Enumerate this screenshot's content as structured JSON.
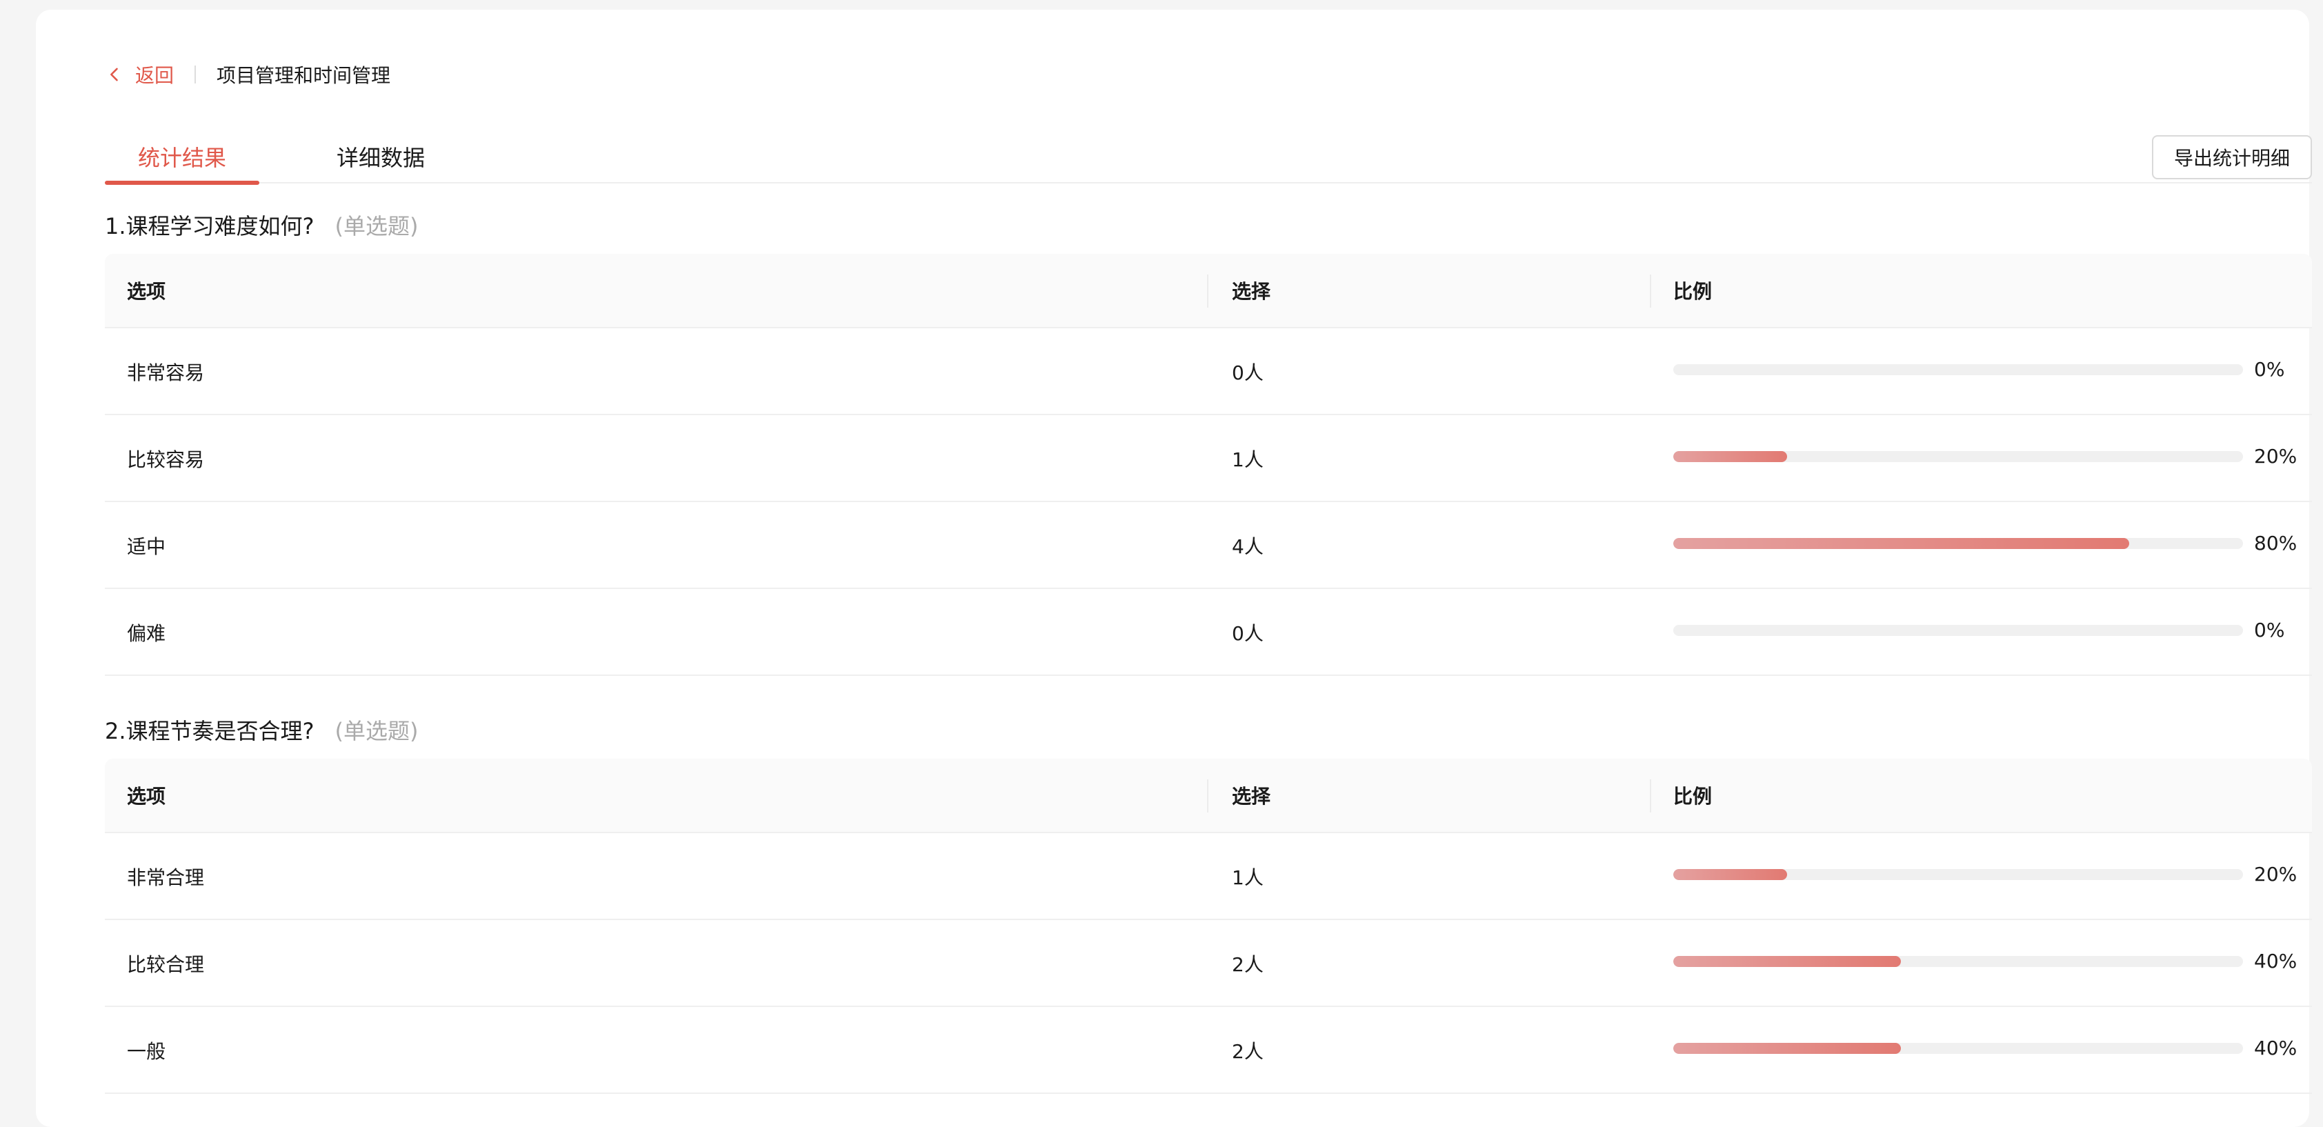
{
  "breadcrumb": {
    "back_label": "返回",
    "title": "项目管理和时间管理"
  },
  "tabs": [
    {
      "label": "统计结果",
      "active": true
    },
    {
      "label": "详细数据",
      "active": false
    }
  ],
  "export_label": "导出统计明细",
  "colors": {
    "accent": "#e0584a",
    "bar_light": "#e4a1a0",
    "bar_dark": "#e27a72",
    "track": "#f0f0f0"
  },
  "table_headers": {
    "option": "选项",
    "count": "选择",
    "ratio": "比例"
  },
  "questions": [
    {
      "title": "1.课程学习难度如何?",
      "type": "(单选题)",
      "rows": [
        {
          "option": "非常容易",
          "count": "0人",
          "percent": 0,
          "percent_label": "0%"
        },
        {
          "option": "比较容易",
          "count": "1人",
          "percent": 20,
          "percent_label": "20%"
        },
        {
          "option": "适中",
          "count": "4人",
          "percent": 80,
          "percent_label": "80%"
        },
        {
          "option": "偏难",
          "count": "0人",
          "percent": 0,
          "percent_label": "0%"
        }
      ]
    },
    {
      "title": "2.课程节奏是否合理?",
      "type": "(单选题)",
      "rows": [
        {
          "option": "非常合理",
          "count": "1人",
          "percent": 20,
          "percent_label": "20%"
        },
        {
          "option": "比较合理",
          "count": "2人",
          "percent": 40,
          "percent_label": "40%"
        },
        {
          "option": "一般",
          "count": "2人",
          "percent": 40,
          "percent_label": "40%"
        }
      ]
    }
  ]
}
